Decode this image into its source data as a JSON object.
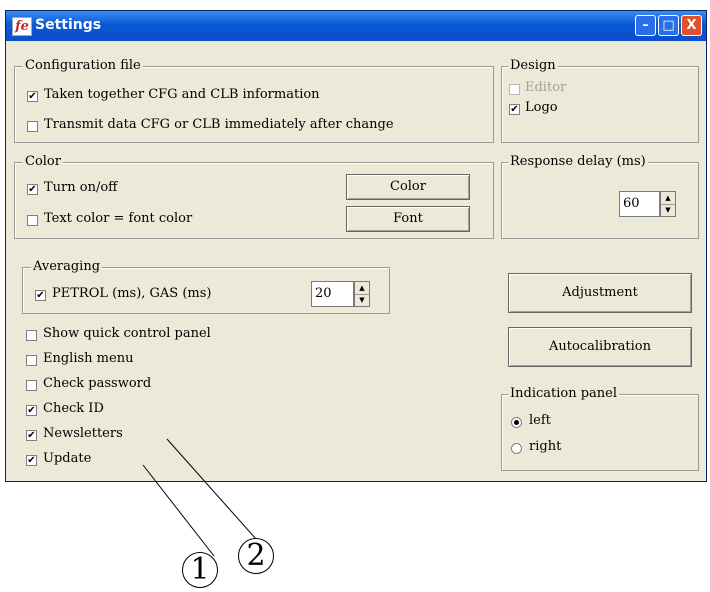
{
  "window": {
    "title": "Settings",
    "icon_letter": "fe"
  },
  "titlebar_buttons": {
    "minimize": "–",
    "maximize": "□",
    "close": "X"
  },
  "config_group": {
    "legend": "Configuration file",
    "items": [
      {
        "label": "Taken together CFG and CLB information",
        "checked": true
      },
      {
        "label": "Transmit data CFG or CLB immediately after change",
        "checked": false
      }
    ]
  },
  "design_group": {
    "legend": "Design",
    "items": [
      {
        "label": "Editor",
        "checked": false,
        "disabled": true
      },
      {
        "label": "Logo",
        "checked": true,
        "disabled": false
      }
    ]
  },
  "color_group": {
    "legend": "Color",
    "items": [
      {
        "label": "Turn on/off",
        "checked": true
      },
      {
        "label": "Text color = font color",
        "checked": false
      }
    ],
    "color_button": "Color",
    "font_button": "Font"
  },
  "response_group": {
    "legend": "Response delay (ms)",
    "value": "60"
  },
  "averaging_group": {
    "legend": "Averaging",
    "item": {
      "label": "PETROL (ms), GAS (ms)",
      "checked": true
    },
    "value": "20"
  },
  "buttons": {
    "adjustment": "Adjustment",
    "autocalibration": "Autocalibration"
  },
  "options": [
    {
      "label": "Show quick control panel",
      "checked": false
    },
    {
      "label": "English menu",
      "checked": false
    },
    {
      "label": "Check password",
      "checked": false
    },
    {
      "label": "Check ID",
      "checked": true
    },
    {
      "label": "Newsletters",
      "checked": true
    },
    {
      "label": "Update",
      "checked": true
    }
  ],
  "indication_group": {
    "legend": "Indication panel",
    "options": [
      {
        "label": "left",
        "selected": true
      },
      {
        "label": "right",
        "selected": false
      }
    ]
  },
  "callouts": [
    "1",
    "2"
  ],
  "check_mark": "✔"
}
